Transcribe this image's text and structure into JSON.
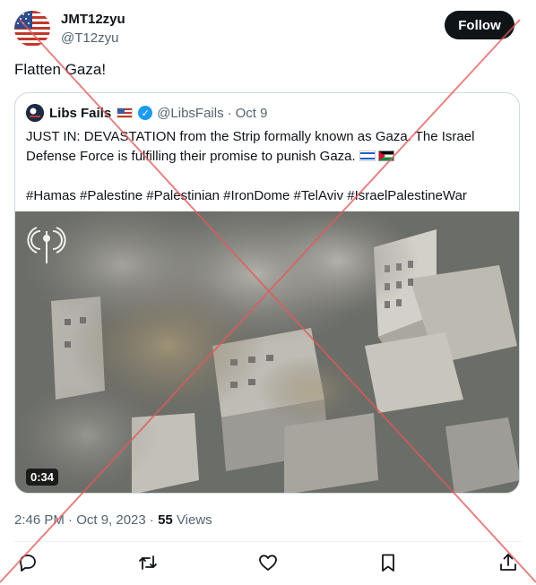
{
  "author": {
    "name": "JMT12zyu",
    "handle": "@T12zyu",
    "follow_label": "Follow"
  },
  "tweet": {
    "text": "Flatten Gaza!"
  },
  "quote": {
    "name": "Libs Fails",
    "handle": "@LibsFails",
    "separator": "·",
    "date": "Oct 9",
    "body": "JUST IN: DEVASTATION from the Strip formally known as Gaza. The Israel Defense Force is fulfilling their promise to punish Gaza.",
    "hashtags": "#Hamas #Palestine #Palestinian #IronDome #TelAviv #IsraelPalestineWar",
    "video_duration": "0:34"
  },
  "footer": {
    "time": "2:46 PM · Oct 9, 2023 ·",
    "views_count": "55",
    "views_label": "Views"
  },
  "icons": {
    "reply": "reply-icon",
    "retweet": "retweet-icon",
    "like": "heart-icon",
    "bookmark": "bookmark-icon",
    "share": "share-icon"
  },
  "colors": {
    "text": "#0f1419",
    "muted": "#536471",
    "verified": "#1d9bf0",
    "overlay_x": "#e05a5a"
  }
}
